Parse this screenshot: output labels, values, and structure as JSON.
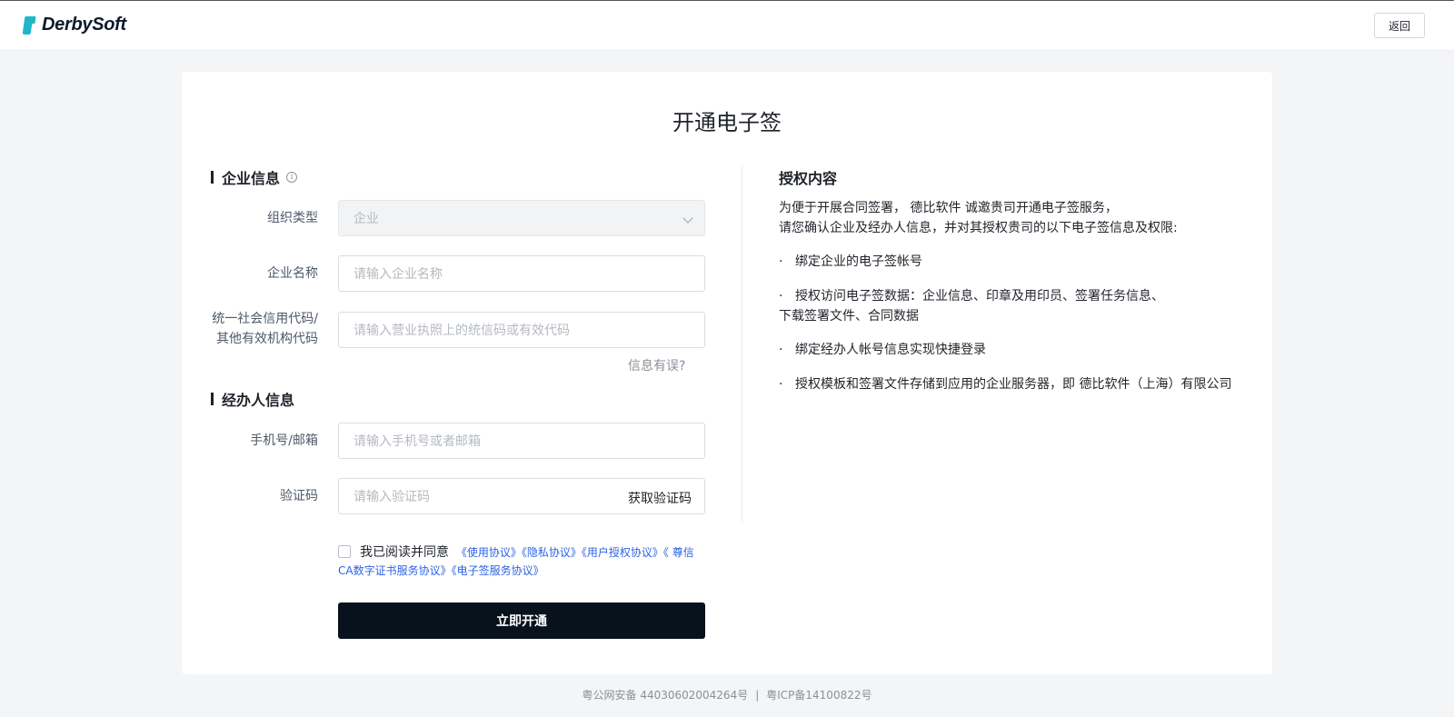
{
  "header": {
    "logo_text": "DerbySoft",
    "back_label": "返回"
  },
  "page": {
    "title": "开通电子签"
  },
  "company_section": {
    "title": "企业信息",
    "org_type": {
      "label": "组织类型",
      "value": "企业"
    },
    "company_name": {
      "label": "企业名称",
      "placeholder": "请输入企业名称"
    },
    "credit_code": {
      "label_line1": "统一社会信用代码/",
      "label_line2": "其他有效机构代码",
      "placeholder": "请输入营业执照上的统信码或有效代码"
    },
    "error_link": "信息有误?"
  },
  "agent_section": {
    "title": "经办人信息",
    "contact": {
      "label": "手机号/邮箱",
      "placeholder": "请输入手机号或者邮箱"
    },
    "code": {
      "label": "验证码",
      "placeholder": "请输入验证码",
      "get_code_label": "获取验证码"
    }
  },
  "agreement": {
    "lead": "我已阅读并同意",
    "links": [
      "《使用协议》",
      "《隐私协议》",
      "《用户授权协议》",
      "《 尊信CA数字证书服务协议》",
      "《电子签服务协议》"
    ]
  },
  "submit_label": "立即开通",
  "authorization": {
    "title": "授权内容",
    "intro_line1": "为便于开展合同签署， 德比软件 诚邀贵司开通电子签服务，",
    "intro_line2": "请您确认企业及经办人信息，并对其授权贵司的以下电子签信息及权限:",
    "bullet_symbol": "·",
    "items": [
      {
        "line1": "绑定企业的电子签帐号",
        "line2": ""
      },
      {
        "line1": "授权访问电子签数据：企业信息、印章及用印员、签署任务信息、",
        "line2": "下载签署文件、合同数据"
      },
      {
        "line1": "绑定经办人帐号信息实现快捷登录",
        "line2": ""
      },
      {
        "line1": "授权模板和签署文件存储到应用的企业服务器，即 德比软件（上海）有限公司",
        "line2": ""
      }
    ]
  },
  "footer": {
    "police": "粤公网安备 44030602004264号",
    "separator": "|",
    "icp": "粤ICP备14100822号"
  }
}
